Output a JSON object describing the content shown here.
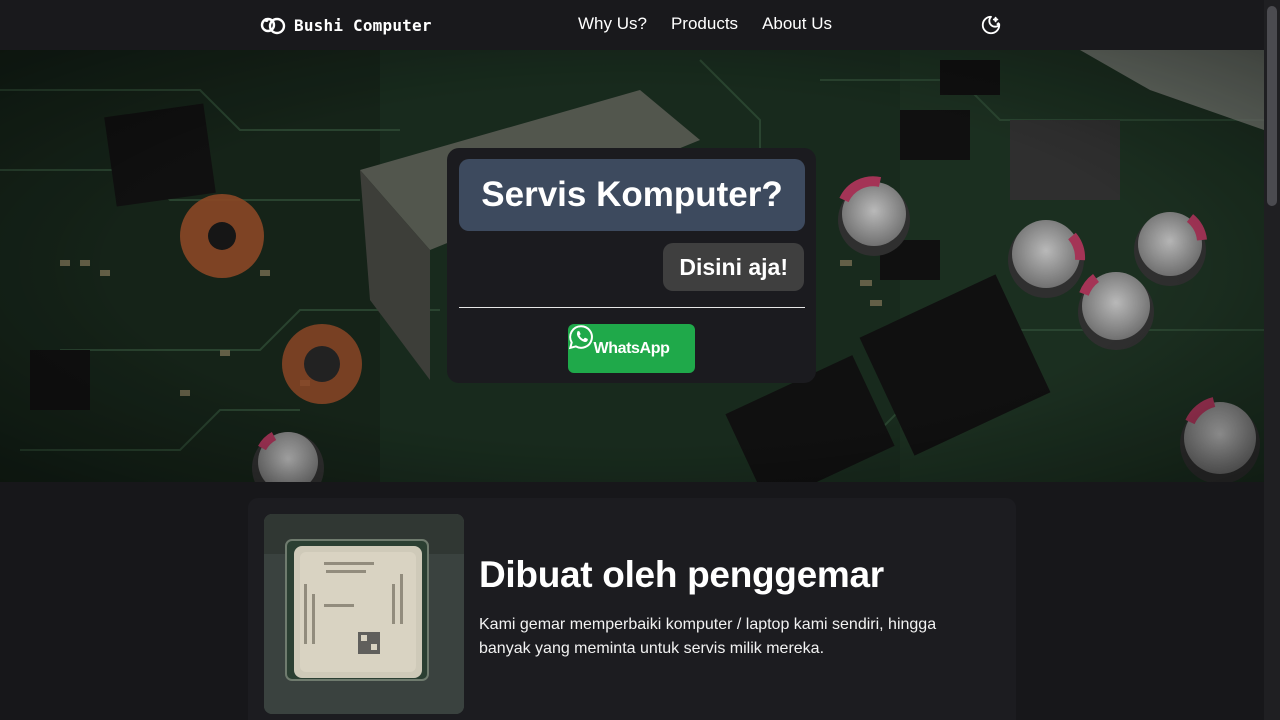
{
  "navbar": {
    "brand": "Bushi Computer",
    "links": [
      "Why Us?",
      "Products",
      "About Us"
    ]
  },
  "hero": {
    "title": "Servis Komputer?",
    "reply": "Disini aja!",
    "cta": "WhatsApp"
  },
  "feature": {
    "title": "Dibuat oleh penggemar",
    "description": "Kami gemar memperbaiki komputer / laptop kami sendiri, hingga banyak yang meminta untuk servis milik mereka."
  },
  "colors": {
    "background": "#17171a",
    "navbar": "#19191c",
    "bubble_title": "#3d4a5e",
    "bubble_reply": "#3f3f3f",
    "whatsapp": "#1fa94a"
  },
  "icons": {
    "brand": "brand-logo-icon",
    "theme": "moon-icon",
    "cta": "whatsapp-icon"
  }
}
